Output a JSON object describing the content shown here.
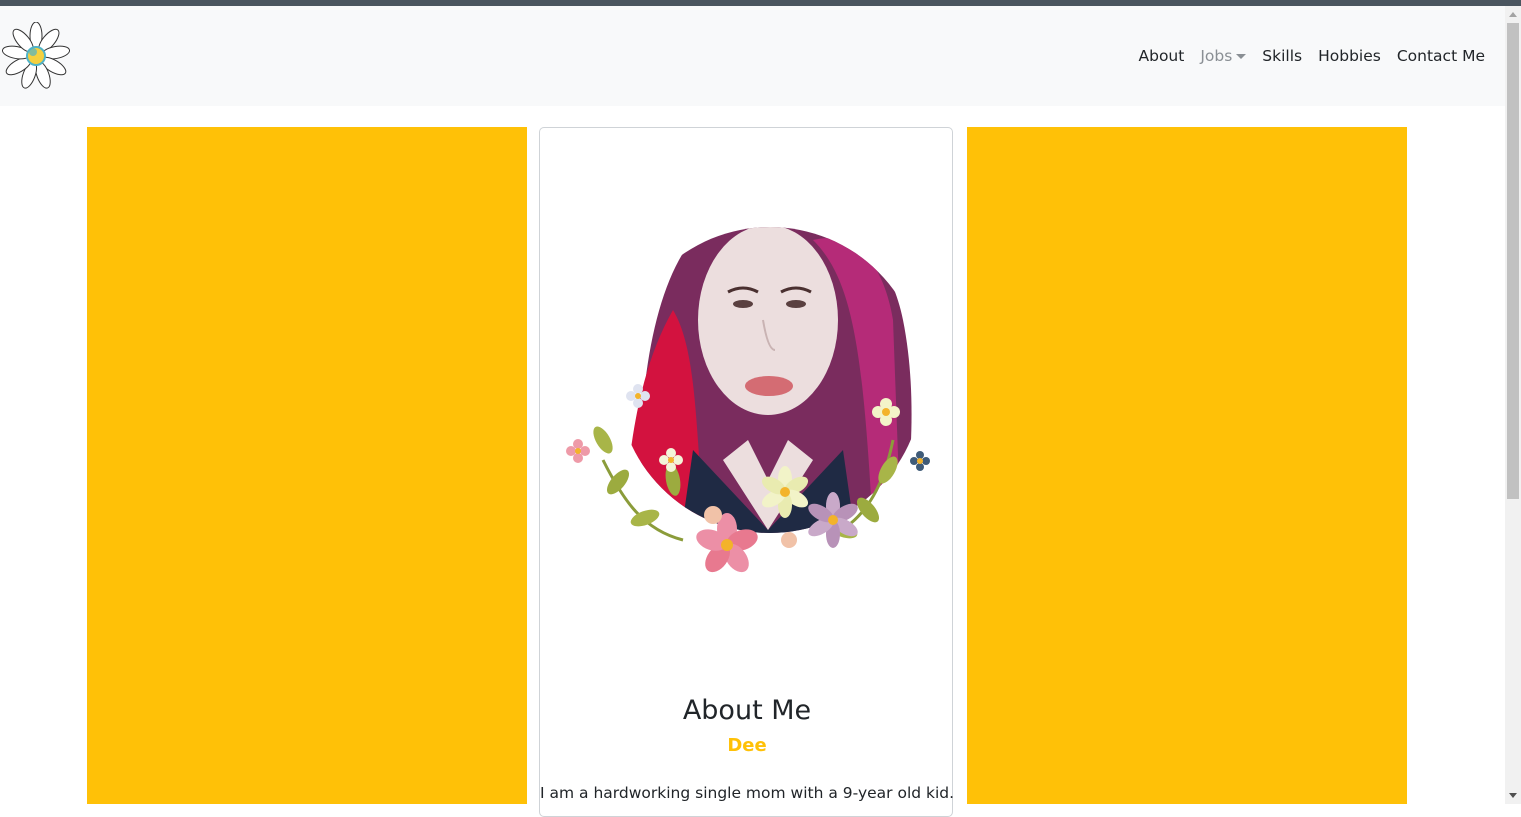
{
  "navbar": {
    "logo_icon": "daisy-logo-icon",
    "links": {
      "about": "About",
      "jobs": "Jobs",
      "skills": "Skills",
      "hobbies": "Hobbies",
      "contact": "Contact Me"
    }
  },
  "card": {
    "image_icon": "profile-photo-with-flower-wreath",
    "title": "About Me",
    "subtitle": "Dee",
    "text": "I am a hardworking single mom with a 9-year old kid."
  },
  "colors": {
    "accent": "#ffc107",
    "navbar_bg": "#f8f9fa",
    "topbar": "#4a555f",
    "muted_link": "#8a8f94"
  }
}
